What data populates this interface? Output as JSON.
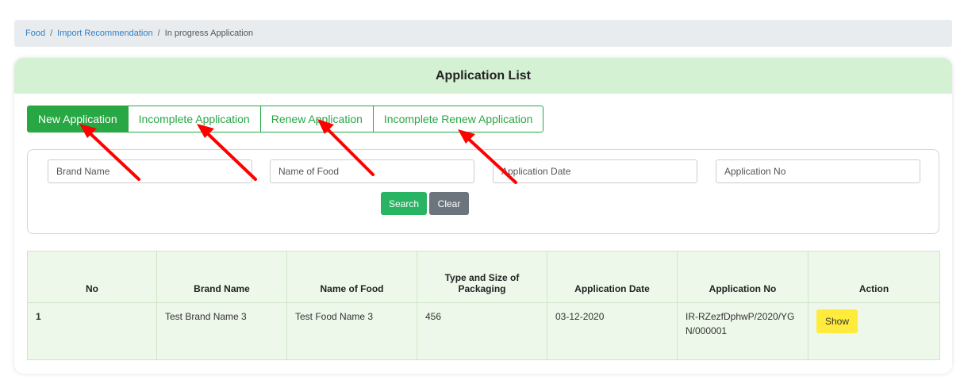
{
  "breadcrumb": {
    "items": [
      "Food",
      "Import Recommendation"
    ],
    "current": "In progress Application",
    "separator": "/"
  },
  "card": {
    "title": "Application List"
  },
  "tabs": [
    {
      "label": "New Application",
      "active": true
    },
    {
      "label": "Incomplete Application",
      "active": false
    },
    {
      "label": "Renew Application",
      "active": false
    },
    {
      "label": "Incomplete Renew Application",
      "active": false
    }
  ],
  "search": {
    "brand_placeholder": "Brand Name",
    "food_placeholder": "Name of Food",
    "date_placeholder": "Application Date",
    "appno_placeholder": "Application No",
    "search_label": "Search",
    "clear_label": "Clear"
  },
  "table": {
    "headers": [
      "No",
      "Brand Name",
      "Name of Food",
      "Type and Size of Packaging",
      "Application Date",
      "Application No",
      "Action"
    ],
    "rows": [
      {
        "no": "1",
        "brand": "Test Brand Name 3",
        "food": "Test Food Name 3",
        "packaging": "456",
        "date": "03-12-2020",
        "app_no": "IR-RZezfDphwP/2020/YGN/000001",
        "action": "Show"
      }
    ]
  },
  "colors": {
    "accent_green": "#28a745",
    "header_green": "#d4f1d4",
    "annotation_red": "#ff0000",
    "show_yellow": "#ffeb3b"
  }
}
